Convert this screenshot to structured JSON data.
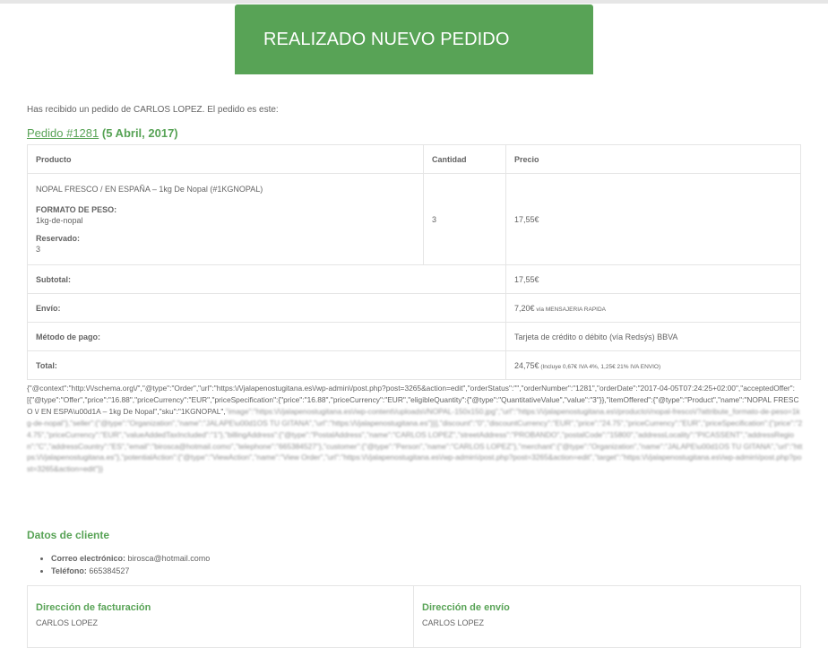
{
  "email": {
    "header_title": "REALIZADO NUEVO PEDIDO",
    "intro": "Has recibido un pedido de CARLOS LOPEZ. El pedido es este:",
    "order_link": "Pedido #1281",
    "order_date": " (5 Abril, 2017)"
  },
  "table": {
    "headers": {
      "product": "Producto",
      "quantity": "Cantidad",
      "price": "Precio"
    },
    "item": {
      "name": "NOPAL FRESCO / EN ESPAÑA – 1kg De Nopal (#1KGNOPAL)",
      "meta1_label": "FORMATO DE PESO:",
      "meta1_value": "1kg-de-nopal",
      "meta2_label": "Reservado:",
      "meta2_value": "3",
      "quantity": "3",
      "price": "17,55€"
    },
    "totals": {
      "subtotal_label": "Subtotal:",
      "subtotal_value": "17,55€",
      "shipping_label": "Envío:",
      "shipping_value": "7,20€",
      "shipping_note": " vía MENSAJERIA RAPIDA",
      "payment_label": "Método de pago:",
      "payment_value": "Tarjeta de crédito o débito (vía Redsýs) BBVA",
      "total_label": "Total:",
      "total_value": "24,75€",
      "total_note": " (Incluye 0,67€ IVA 4%, 1,25€ 21% IVA ENVIO)"
    }
  },
  "json_ld": {
    "clear": "{\"@context\":\"http:\\/\\/schema.org\\/\",\"@type\":\"Order\",\"url\":\"https:\\/\\/jalapenostugitana.es\\/wp-admin\\/post.php?post=3265&action=edit\",\"orderStatus\":\"\",\"orderNumber\":\"1281\",\"orderDate\":\"2017-04-05T07:24:25+02:00\",\"acceptedOffer\":[{\"@type\":\"Offer\",\"price\":\"16.88\",\"priceCurrency\":\"EUR\",\"priceSpecification\":{\"price\":\"16.88\",\"priceCurrency\":\"EUR\",\"eligibleQuantity\":{\"@type\":\"QuantitativeValue\",\"value\":\"3\"}},\"itemOffered\":{\"@type\":\"Product\",\"name\":\"NOPAL FRESCO \\/ EN ESPA\\u00d1A – 1kg De Nopal\",\"sku\":\"1KGNOPAL\",",
    "blurred": "\"image\":\"https:\\/\\/jalapenostugitana.es\\/wp-content\\/uploads\\/NOPAL-150x150.jpg\",\"url\":\"https:\\/\\/jalapenostugitana.es\\/producto\\/nopal-fresco\\/?attribute_formato-de-peso=1kg-de-nopal\"},\"seller\":{\"@type\":\"Organization\",\"name\":\"JALAPE\\u00d1OS TU GITANA\",\"url\":\"https:\\/\\/jalapenostugitana.es\"}}],\"discount\":\"0\",\"discountCurrency\":\"EUR\",\"price\":\"24.75\",\"priceCurrency\":\"EUR\",\"priceSpecification\":{\"price\":\"24.75\",\"priceCurrency\":\"EUR\",\"valueAddedTaxIncluded\":\"1\"},\"billingAddress\":{\"@type\":\"PostalAddress\",\"name\":\"CARLOS LOPEZ\",\"streetAddress\":\"PROBANDO\",\"postalCode\":\"15800\",\"addressLocality\":\"PICASSENT\",\"addressRegion\":\"C\",\"addressCountry\":\"ES\",\"email\":\"birosca@hotmail.como\",\"telephone\":\"665384527\"},\"customer\":{\"@type\":\"Person\",\"name\":\"CARLOS LOPEZ\"},\"merchant\":{\"@type\":\"Organization\",\"name\":\"JALAPE\\u00d1OS TU GITANA\",\"url\":\"https:\\/\\/jalapenostugitana.es\"},\"potentialAction\":{\"@type\":\"ViewAction\",\"name\":\"View Order\",\"url\":\"https:\\/\\/jalapenostugitana.es\\/wp-admin\\/post.php?post=3265&action=edit\",\"target\":\"https:\\/\\/jalapenostugitana.es\\/wp-admin\\/post.php?post=3265&action=edit\"}}"
  },
  "customer": {
    "title": "Datos de cliente",
    "email_label": "Correo electrónico:",
    "email_value": " birosca@hotmail.como",
    "phone_label": "Teléfono:",
    "phone_value": " 665384527"
  },
  "addresses": {
    "billing_title": "Dirección de facturación",
    "billing_name": "CARLOS LOPEZ",
    "shipping_title": "Dirección de envío",
    "shipping_name": "CARLOS LOPEZ"
  },
  "colors": {
    "accent": "#58a356",
    "text": "#636363",
    "border": "#e5e5e5"
  }
}
